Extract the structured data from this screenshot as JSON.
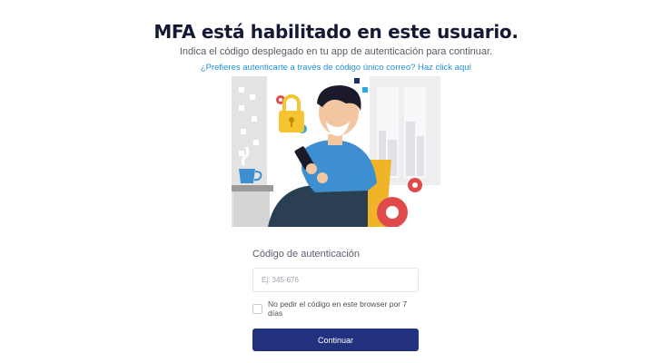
{
  "header": {
    "title": "MFA está habilitado en este usuario.",
    "subtitle": "Indica el código desplegado en tu app de autenticación para continuar.",
    "alt_link": "¿Prefieres autenticarte a través de código único correo? Haz click aquí"
  },
  "illustration": {
    "icons": [
      "lock-icon",
      "gear-icon",
      "coffee-cup-icon",
      "smartphone-icon"
    ],
    "colors": {
      "shirt": "#3d8fd1",
      "lock": "#f5c431",
      "gear": "#e04a4a",
      "chair": "#f0b429",
      "pants": "#2a3f52"
    }
  },
  "form": {
    "code_label": "Código de autenticación",
    "code_placeholder": "Ej: 345-676",
    "code_value": "",
    "remember_label": "No pedir el código en este browser por 7 días",
    "remember_checked": false,
    "submit_label": "Continuar"
  },
  "colors": {
    "primary_button": "#23327f",
    "link": "#1f8fd6",
    "title": "#141a33"
  }
}
